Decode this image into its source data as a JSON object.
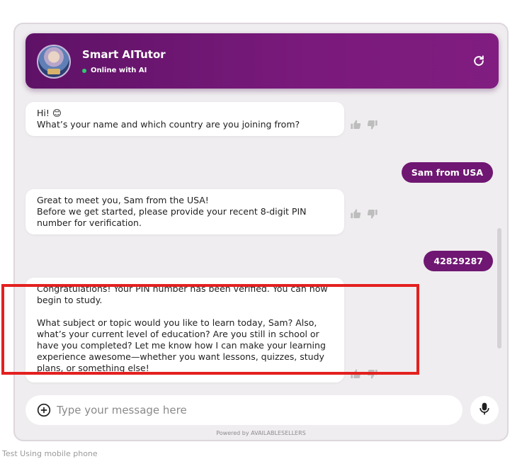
{
  "header": {
    "title": "Smart AITutor",
    "status": "Online with AI",
    "status_color": "#2ecc71",
    "accent_color": "#6f1772"
  },
  "messages": [
    {
      "role": "bot",
      "lines": [
        "Hi! 😊",
        "What’s your name and which country are you joining from?"
      ]
    },
    {
      "role": "user",
      "text": "Sam from USA"
    },
    {
      "role": "bot",
      "lines": [
        "Great to meet you, Sam from the USA!",
        "Before we get started, please provide your recent 8-digit PIN number for verification."
      ]
    },
    {
      "role": "user",
      "text": "42829287"
    },
    {
      "role": "bot",
      "lines": [
        "Congratulations! Your PIN number has been verified. You can now begin to study.",
        "What subject or topic would you like to learn today, Sam? Also, what’s your current level of education? Are you still in school or have you completed? Let me know how I can make your learning experience awesome—whether you want lessons, quizzes, study plans, or something else!"
      ]
    }
  ],
  "input": {
    "placeholder": "Type your message here"
  },
  "footer": {
    "powered_by": "Powered by AVAILABLESELLERS",
    "below_text": "Test Using mobile phone"
  },
  "icons": {
    "refresh": "refresh-icon",
    "thumbs_up": "thumbs-up-icon",
    "thumbs_down": "thumbs-down-icon",
    "add": "plus-circle-icon",
    "mic": "microphone-icon"
  }
}
